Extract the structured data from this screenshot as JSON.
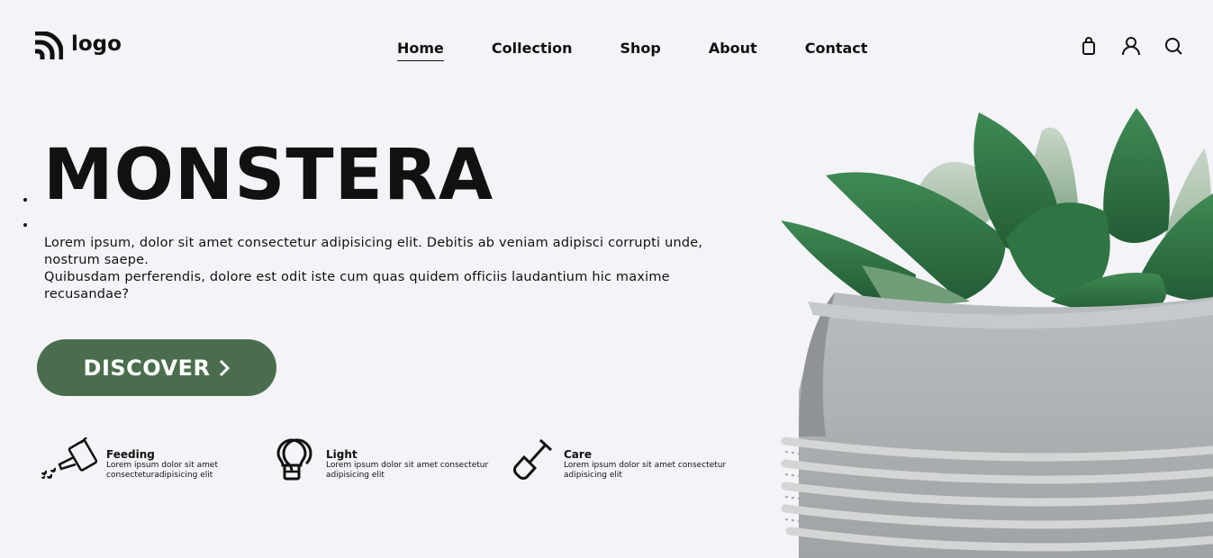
{
  "brand": {
    "logo_text": "logo"
  },
  "nav": [
    {
      "label": "Home",
      "active": true
    },
    {
      "label": "Collection",
      "active": false
    },
    {
      "label": "Shop",
      "active": false
    },
    {
      "label": "About",
      "active": false
    },
    {
      "label": "Contact",
      "active": false
    }
  ],
  "header_icons": [
    "shopping-bag-icon",
    "user-icon",
    "search-icon"
  ],
  "hero": {
    "title": "MONSTERA",
    "desc_line1": "Lorem ipsum, dolor sit amet consectetur adipisicing elit. Debitis ab veniam adipisci corrupti unde, nostrum saepe.",
    "desc_line2": "Quibusdam perferendis, dolore est odit iste cum quas quidem officiis laudantium hic maxime recusandae?",
    "button_label": "DISCOVER"
  },
  "features": [
    {
      "icon": "watering-can-icon",
      "title": "Feeding",
      "text": "Lorem ipsum dolor sit amet consecteturadipisicing elit"
    },
    {
      "icon": "light-bulb-icon",
      "title": "Light",
      "text": "Lorem ipsum dolor sit amet consectetur adipisicing elit"
    },
    {
      "icon": "shovel-icon",
      "title": "Care",
      "text": "Lorem ipsum dolor sit amet consectetur adipisicing elit"
    }
  ],
  "colors": {
    "background": "#f4f3f7",
    "accent": "#4a6e4d",
    "text": "#111111"
  }
}
